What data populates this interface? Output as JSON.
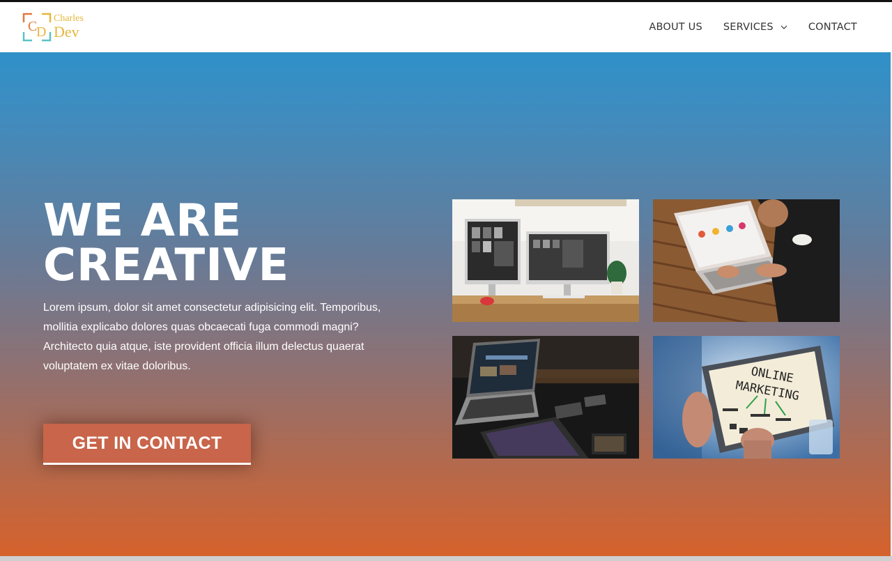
{
  "header": {
    "logo": {
      "line1": "Charles",
      "line2": "Dev",
      "mark_letters": "CD"
    },
    "nav": [
      {
        "label": "ABOUT US"
      },
      {
        "label": "SERVICES"
      },
      {
        "label": "CONTACT"
      }
    ]
  },
  "hero": {
    "headline_line1": "WE ARE",
    "headline_line2": "CREATIVE",
    "lead": "Lorem ipsum, dolor sit amet consectetur adipisicing elit. Temporibus, mollitia explicabo dolores quas obcaecati fuga commodi magni? Architecto quia atque, iste provident officia illum delectus quaerat voluptatem ex vitae doloribus.",
    "cta_label": "GET IN CONTACT"
  },
  "gallery": {
    "tile4_text_line1": "ONLINE",
    "tile4_text_line2": "MARKETING"
  },
  "colors": {
    "brand_gold": "#e6b73c",
    "hero_top": "#2f91c8",
    "hero_bottom": "#d6622c",
    "cta_bg": "#c8654a"
  }
}
